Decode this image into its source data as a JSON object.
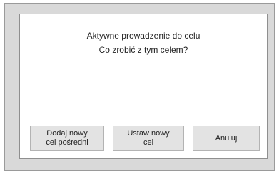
{
  "dialog": {
    "line1": "Aktywne prowadzenie do celu",
    "line2": "Co zrobić z tym celem?"
  },
  "buttons": {
    "add_waypoint": "Dodaj nowy\ncel pośredni",
    "set_destination": "Ustaw nowy\ncel",
    "cancel": "Anuluj"
  }
}
